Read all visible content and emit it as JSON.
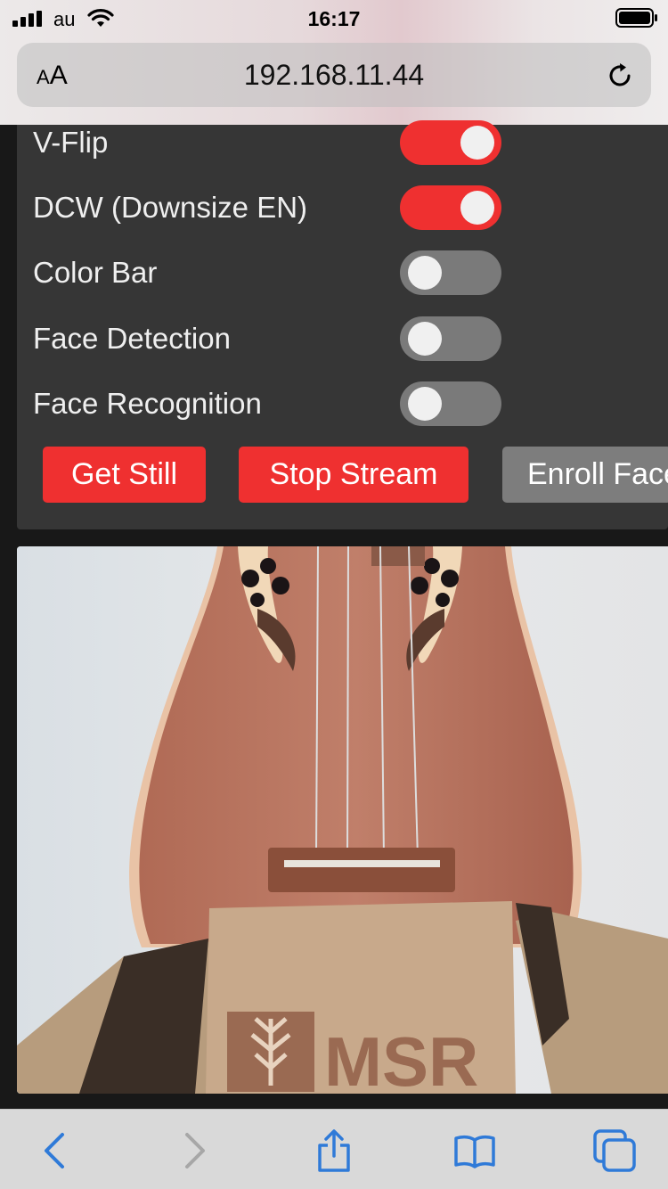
{
  "status_bar": {
    "carrier": "au",
    "time": "16:17"
  },
  "browser": {
    "aa_label_small": "A",
    "aa_label_large": "A",
    "url": "192.168.11.44",
    "icons": [
      "signal-icon",
      "wifi-icon",
      "battery-icon",
      "reload-icon",
      "back-icon",
      "forward-icon",
      "share-icon",
      "bookmarks-icon",
      "tabs-icon"
    ]
  },
  "settings": {
    "toggles": [
      {
        "label": "V-Flip",
        "state": "on"
      },
      {
        "label": "DCW (Downsize EN)",
        "state": "on"
      },
      {
        "label": "Color Bar",
        "state": "off"
      },
      {
        "label": "Face Detection",
        "state": "off"
      },
      {
        "label": "Face Recognition",
        "state": "off"
      }
    ],
    "buttons": {
      "get_still": "Get Still",
      "stop_stream": "Stop Stream",
      "enroll_face": "Enroll Face"
    }
  },
  "stream": {
    "logo_text": "MSR"
  },
  "colors": {
    "accent_red": "#ef3030",
    "toggle_off": "#7a7a7a",
    "panel_bg": "#363636",
    "page_bg": "#181818",
    "ios_blue": "#2f7ad8"
  }
}
